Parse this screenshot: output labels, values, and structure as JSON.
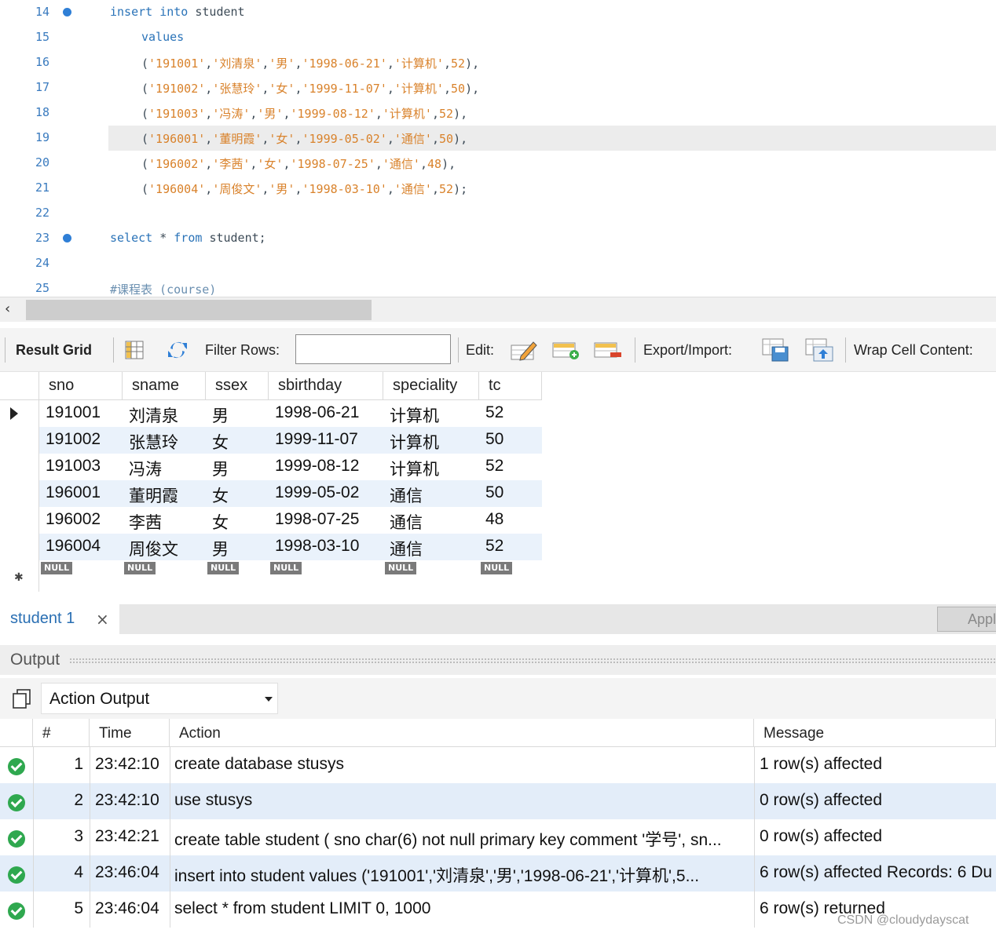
{
  "editor": {
    "lines": [
      {
        "n": "14",
        "bp": true,
        "indent": 0,
        "parts": [
          [
            "kw",
            "insert into "
          ],
          [
            "plain",
            "student"
          ]
        ]
      },
      {
        "n": "15",
        "bp": false,
        "indent": 1,
        "parts": [
          [
            "kw",
            "values"
          ]
        ]
      },
      {
        "n": "16",
        "bp": false,
        "indent": 1,
        "parts": [
          [
            "plain",
            "("
          ],
          [
            "str",
            "'191001'"
          ],
          [
            "plain",
            ","
          ],
          [
            "str",
            "'刘清泉'"
          ],
          [
            "plain",
            ","
          ],
          [
            "str",
            "'男'"
          ],
          [
            "plain",
            ","
          ],
          [
            "str",
            "'1998-06-21'"
          ],
          [
            "plain",
            ","
          ],
          [
            "str",
            "'计算机'"
          ],
          [
            "plain",
            ","
          ],
          [
            "num",
            "52"
          ],
          [
            "plain",
            "),"
          ]
        ]
      },
      {
        "n": "17",
        "bp": false,
        "indent": 1,
        "parts": [
          [
            "plain",
            "("
          ],
          [
            "str",
            "'191002'"
          ],
          [
            "plain",
            ","
          ],
          [
            "str",
            "'张慧玲'"
          ],
          [
            "plain",
            ","
          ],
          [
            "str",
            "'女'"
          ],
          [
            "plain",
            ","
          ],
          [
            "str",
            "'1999-11-07'"
          ],
          [
            "plain",
            ","
          ],
          [
            "str",
            "'计算机'"
          ],
          [
            "plain",
            ","
          ],
          [
            "num",
            "50"
          ],
          [
            "plain",
            "),"
          ]
        ]
      },
      {
        "n": "18",
        "bp": false,
        "indent": 1,
        "parts": [
          [
            "plain",
            "("
          ],
          [
            "str",
            "'191003'"
          ],
          [
            "plain",
            ","
          ],
          [
            "str",
            "'冯涛'"
          ],
          [
            "plain",
            ","
          ],
          [
            "str",
            "'男'"
          ],
          [
            "plain",
            ","
          ],
          [
            "str",
            "'1999-08-12'"
          ],
          [
            "plain",
            ","
          ],
          [
            "str",
            "'计算机'"
          ],
          [
            "plain",
            ","
          ],
          [
            "num",
            "52"
          ],
          [
            "plain",
            "),"
          ]
        ]
      },
      {
        "n": "19",
        "bp": false,
        "indent": 1,
        "current": true,
        "parts": [
          [
            "plain",
            "("
          ],
          [
            "str",
            "'196001'"
          ],
          [
            "plain",
            ","
          ],
          [
            "str",
            "'董明霞'"
          ],
          [
            "plain",
            ","
          ],
          [
            "str",
            "'女'"
          ],
          [
            "plain",
            ","
          ],
          [
            "str",
            "'1999-05-02'"
          ],
          [
            "plain",
            ","
          ],
          [
            "str",
            "'通信'"
          ],
          [
            "plain",
            ","
          ],
          [
            "num",
            "50"
          ],
          [
            "plain",
            "),"
          ]
        ]
      },
      {
        "n": "20",
        "bp": false,
        "indent": 1,
        "parts": [
          [
            "plain",
            "("
          ],
          [
            "str",
            "'196002'"
          ],
          [
            "plain",
            ","
          ],
          [
            "str",
            "'李茜'"
          ],
          [
            "plain",
            ","
          ],
          [
            "str",
            "'女'"
          ],
          [
            "plain",
            ","
          ],
          [
            "str",
            "'1998-07-25'"
          ],
          [
            "plain",
            ","
          ],
          [
            "str",
            "'通信'"
          ],
          [
            "plain",
            ","
          ],
          [
            "num",
            "48"
          ],
          [
            "plain",
            "),"
          ]
        ]
      },
      {
        "n": "21",
        "bp": false,
        "indent": 1,
        "parts": [
          [
            "plain",
            "("
          ],
          [
            "str",
            "'196004'"
          ],
          [
            "plain",
            ","
          ],
          [
            "str",
            "'周俊文'"
          ],
          [
            "plain",
            ","
          ],
          [
            "str",
            "'男'"
          ],
          [
            "plain",
            ","
          ],
          [
            "str",
            "'1998-03-10'"
          ],
          [
            "plain",
            ","
          ],
          [
            "str",
            "'通信'"
          ],
          [
            "plain",
            ","
          ],
          [
            "num",
            "52"
          ],
          [
            "plain",
            ");"
          ]
        ]
      },
      {
        "n": "22",
        "bp": false,
        "indent": 0,
        "parts": []
      },
      {
        "n": "23",
        "bp": true,
        "indent": 0,
        "parts": [
          [
            "kw",
            "select "
          ],
          [
            "plain",
            "* "
          ],
          [
            "kw",
            "from "
          ],
          [
            "plain",
            "student;"
          ]
        ]
      },
      {
        "n": "24",
        "bp": false,
        "indent": 0,
        "parts": []
      },
      {
        "n": "25",
        "bp": false,
        "indent": 0,
        "parts": [
          [
            "cmt",
            "#课程表 (course)"
          ]
        ]
      }
    ]
  },
  "toolbar": {
    "result_grid": "Result Grid",
    "filter_rows": "Filter Rows:",
    "filter_value": "",
    "edit": "Edit:",
    "export_import": "Export/Import:",
    "wrap_cell": "Wrap Cell Content:"
  },
  "grid": {
    "columns": [
      "sno",
      "sname",
      "ssex",
      "sbirthday",
      "speciality",
      "tc"
    ],
    "rows": [
      [
        "191001",
        "刘清泉",
        "男",
        "1998-06-21",
        "计算机",
        "52"
      ],
      [
        "191002",
        "张慧玲",
        "女",
        "1999-11-07",
        "计算机",
        "50"
      ],
      [
        "191003",
        "冯涛",
        "男",
        "1999-08-12",
        "计算机",
        "52"
      ],
      [
        "196001",
        "董明霞",
        "女",
        "1999-05-02",
        "通信",
        "50"
      ],
      [
        "196002",
        "李茜",
        "女",
        "1998-07-25",
        "通信",
        "48"
      ],
      [
        "196004",
        "周俊文",
        "男",
        "1998-03-10",
        "通信",
        "52"
      ]
    ],
    "null_label": "NULL"
  },
  "tabs": {
    "student_tab": "student 1",
    "close_glyph": "×",
    "apply_label": "Appl"
  },
  "output": {
    "title": "Output",
    "selector_value": "Action Output",
    "columns": [
      "#",
      "Time",
      "Action",
      "Message"
    ],
    "rows": [
      {
        "n": "1",
        "time": "23:42:10",
        "action": "create database stusys",
        "message": "1 row(s) affected"
      },
      {
        "n": "2",
        "time": "23:42:10",
        "action": "use stusys",
        "message": "0 row(s) affected"
      },
      {
        "n": "3",
        "time": "23:42:21",
        "action": "create table student ( sno char(6) not null primary key comment '学号',      sn...",
        "message": "0 row(s) affected"
      },
      {
        "n": "4",
        "time": "23:46:04",
        "action": "insert into student values      ('191001','刘清泉','男','1998-06-21','计算机',5...",
        "message": "6 row(s) affected Records: 6  Du"
      },
      {
        "n": "5",
        "time": "23:46:04",
        "action": "select * from student LIMIT 0, 1000",
        "message": "6 row(s) returned"
      }
    ]
  },
  "watermark": "CSDN @cloudydayscat",
  "colors": {
    "keyword": "#2a73b8",
    "string": "#d9822b",
    "alt_row": "#eaf2fb",
    "success": "#2fa84f"
  }
}
